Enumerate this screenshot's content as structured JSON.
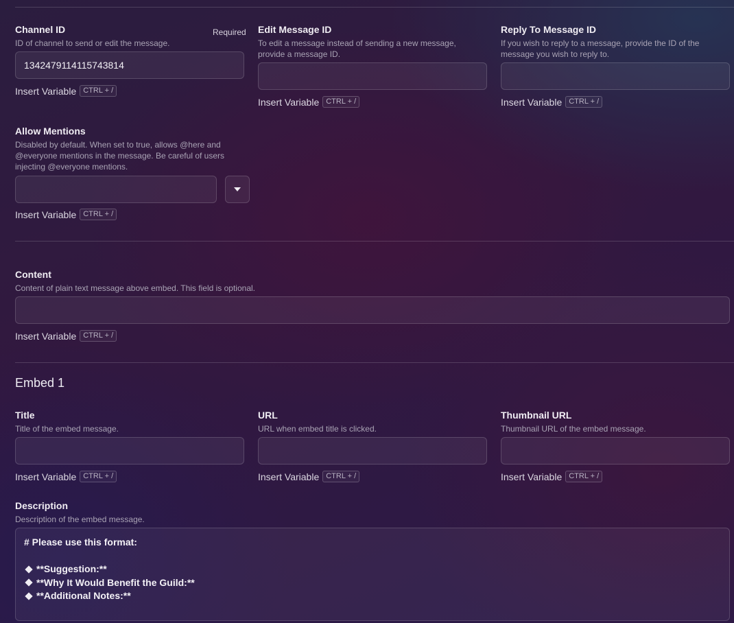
{
  "channel_id": {
    "label": "Channel ID",
    "required_label": "Required",
    "help": "ID of channel to send or edit the message.",
    "value": "1342479114115743814"
  },
  "edit_message_id": {
    "label": "Edit Message ID",
    "help": "To edit a message instead of sending a new message, provide a message ID.",
    "value": ""
  },
  "reply_to_message_id": {
    "label": "Reply To Message ID",
    "help": "If you wish to reply to a message, provide the ID of the message you wish to reply to.",
    "value": ""
  },
  "allow_mentions": {
    "label": "Allow Mentions",
    "help": "Disabled by default. When set to true, allows @here and @everyone mentions in the message. Be careful of users injecting @everyone mentions.",
    "value": "",
    "dropdown_icon": "caret-down-icon"
  },
  "content": {
    "label": "Content",
    "help": "Content of plain text message above embed. This field is optional.",
    "value": ""
  },
  "embed": {
    "section_title": "Embed 1",
    "title": {
      "label": "Title",
      "help": "Title of the embed message.",
      "value": ""
    },
    "url": {
      "label": "URL",
      "help": "URL when embed title is clicked.",
      "value": ""
    },
    "thumbnail_url": {
      "label": "Thumbnail URL",
      "help": "Thumbnail URL of the embed message.",
      "value": ""
    },
    "description": {
      "label": "Description",
      "help": "Description of the embed message.",
      "lines": [
        "# Please use this format:",
        "",
        "**Suggestion:**",
        "**Why It Would Benefit the Guild:**",
        "**Additional Notes:**"
      ]
    }
  },
  "insert_variable": {
    "label": "Insert Variable",
    "shortcut": "CTRL + /"
  }
}
